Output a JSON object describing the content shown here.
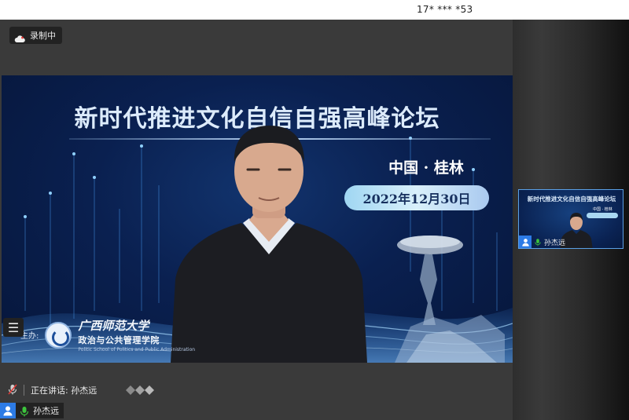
{
  "topbar": {
    "meeting_id": "17* *** *53"
  },
  "recording": {
    "label": "录制中",
    "icon": "cloud-icon"
  },
  "shared_video": {
    "forum_title": "新时代推进文化自信自强高峰论坛",
    "location": "中国 · 桂林",
    "date": "2022年12月30日",
    "host_label": "主办:",
    "host_name_line1": "广西师范大学",
    "host_name_line2": "政治与公共管理学院",
    "host_name_line3": "Politic School of Politics and Public Administration"
  },
  "menu": {
    "icon": "menu-icon",
    "glyph": "☰"
  },
  "speaking": {
    "label": "正在讲话: 孙杰远"
  },
  "self_tag": {
    "name": "孙杰远"
  },
  "thumbnail": {
    "title": "新时代推进文化自信自强高峰论坛",
    "location": "中国 · 桂林",
    "name": "孙杰远"
  },
  "colors": {
    "accent": "#2d7be5",
    "mic_active": "#3cc43c",
    "video_bg": "#0a2050"
  }
}
